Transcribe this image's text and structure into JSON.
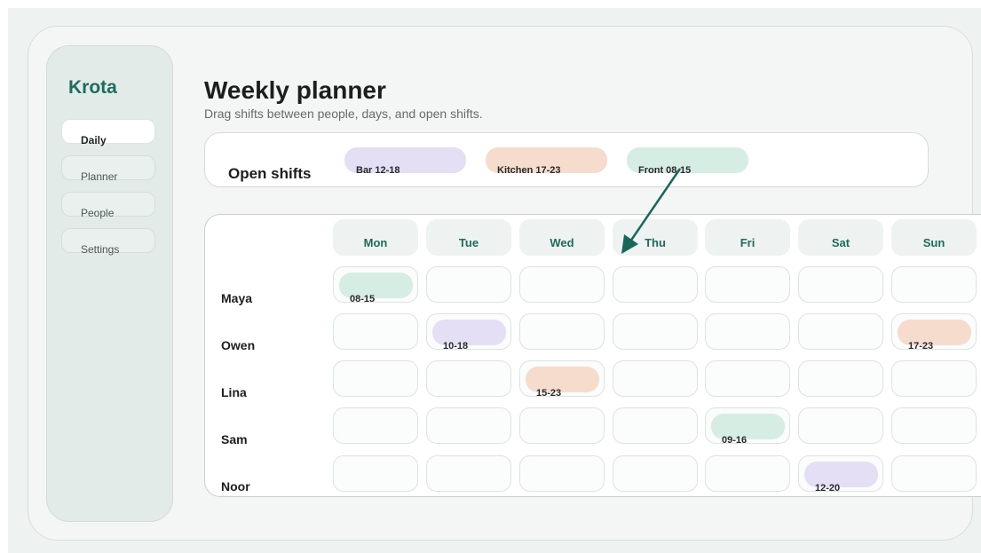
{
  "app": {
    "brand": "Krota"
  },
  "sidebar": {
    "items": [
      {
        "label": "Daily",
        "active": true
      },
      {
        "label": "Planner",
        "active": false
      },
      {
        "label": "People",
        "active": false
      },
      {
        "label": "Settings",
        "active": false
      }
    ]
  },
  "header": {
    "title": "Weekly planner",
    "subtitle": "Drag shifts between people, days, and open shifts."
  },
  "open_shifts": {
    "label": "Open shifts",
    "chips": [
      {
        "label": "Bar 12-18",
        "color": "#e4dff5"
      },
      {
        "label": "Kitchen 17-23",
        "color": "#f6dccd"
      },
      {
        "label": "Front 08-15",
        "color": "#d6ede4"
      }
    ]
  },
  "planner": {
    "days": [
      "Mon",
      "Tue",
      "Wed",
      "Thu",
      "Fri",
      "Sat",
      "Sun"
    ],
    "people": [
      "Maya",
      "Owen",
      "Lina",
      "Sam",
      "Noor"
    ],
    "shifts": [
      {
        "person": 0,
        "day": 0,
        "label": "08-15",
        "color": "#d6ede4"
      },
      {
        "person": 1,
        "day": 1,
        "label": "10-18",
        "color": "#e4dff5"
      },
      {
        "person": 1,
        "day": 6,
        "label": "17-23",
        "color": "#f6dccd"
      },
      {
        "person": 2,
        "day": 2,
        "label": "15-23",
        "color": "#f6dccd"
      },
      {
        "person": 3,
        "day": 4,
        "label": "09-16",
        "color": "#d6ede4"
      },
      {
        "person": 4,
        "day": 5,
        "label": "12-20",
        "color": "#e4dff5"
      }
    ]
  },
  "drag_indicator": {
    "from": "Front 08-15",
    "to_day": "Thu",
    "color": "#17675a"
  }
}
